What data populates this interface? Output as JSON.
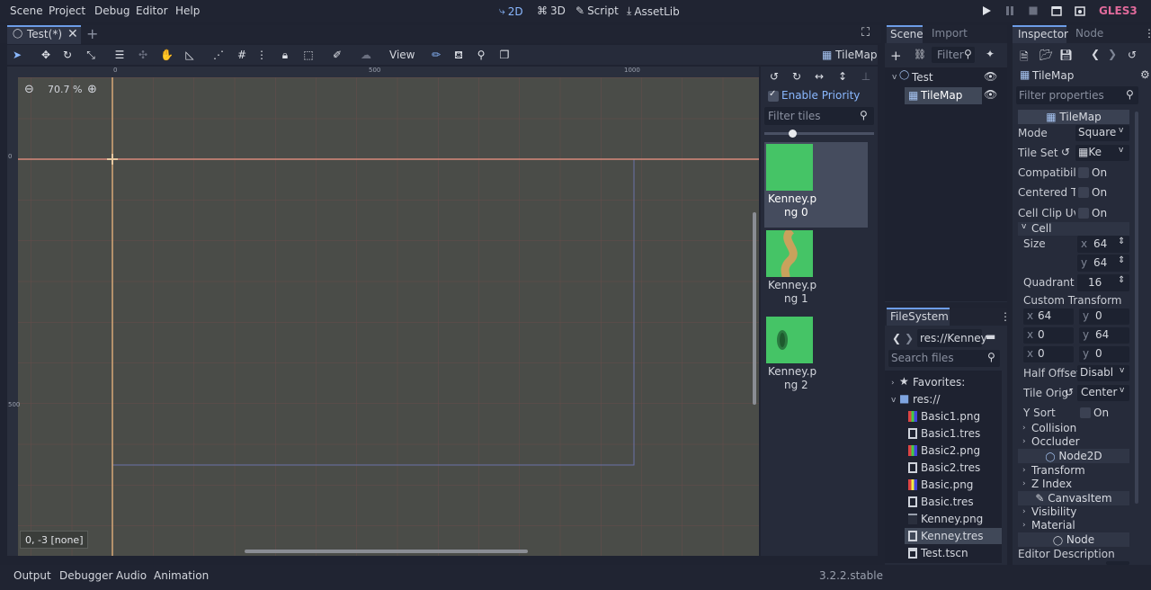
{
  "menu": {
    "items": [
      "Scene",
      "Project",
      "Debug",
      "Editor",
      "Help"
    ]
  },
  "workspaces": {
    "items": [
      "2D",
      "3D",
      "Script",
      "AssetLib"
    ],
    "active": "2D"
  },
  "renderer": {
    "label": "GLES3",
    "color": "#e06a9b"
  },
  "scene_tabs": {
    "tab_label": "Test(*)"
  },
  "toolbar": {
    "view_label": "View",
    "node_label": "TileMap"
  },
  "viewport": {
    "zoom": "70.7 %",
    "status": "0, -3 [none]",
    "ruler_h": [
      "0",
      "500",
      "1000"
    ],
    "ruler_v": [
      "0",
      "500"
    ]
  },
  "tile_palette": {
    "enable_priority": "Enable Priority",
    "filter_placeholder": "Filter tiles",
    "tiles": [
      {
        "label": "Kenney.png 0",
        "line1": "Kenney.p",
        "line2": "ng 0"
      },
      {
        "label": "Kenney.png 1",
        "line1": "Kenney.p",
        "line2": "ng 1"
      },
      {
        "label": "Kenney.png 2",
        "line1": "Kenney.p",
        "line2": "ng 2"
      }
    ]
  },
  "scene_dock": {
    "tabs": [
      "Scene",
      "Import"
    ],
    "filter_placeholder": "Filter",
    "nodes": [
      {
        "name": "Test"
      },
      {
        "name": "TileMap"
      }
    ]
  },
  "filesystem_dock": {
    "title": "FileSystem",
    "path": "res://Kenney",
    "search_placeholder": "Search files",
    "favorites": "Favorites:",
    "root": "res://",
    "files": [
      "Basic1.png",
      "Basic1.tres",
      "Basic2.png",
      "Basic2.tres",
      "Basic.png",
      "Basic.tres",
      "Kenney.png",
      "Kenney.tres",
      "Test.tscn"
    ],
    "selected": "Kenney.tres"
  },
  "inspector": {
    "tabs": [
      "Inspector",
      "Node"
    ],
    "object": "TileMap",
    "filter_placeholder": "Filter properties",
    "section": "TileMap",
    "props": {
      "mode_label": "Mode",
      "mode_value": "Square",
      "tileset_label": "Tile Set",
      "tileset_value": "Ke",
      "compat_label": "Compatibili",
      "compat_value": "On",
      "centered_label": "Centered T",
      "centered_value": "On",
      "clip_label": "Cell Clip Uv",
      "clip_value": "On",
      "cell_group": "Cell",
      "size_label": "Size",
      "size_x": "64",
      "size_y": "64",
      "quadrant_label": "Quadrant S",
      "quadrant_value": "16",
      "custom_transform": "Custom Transform",
      "ct": [
        "64",
        "0",
        "0",
        "64",
        "0",
        "0"
      ],
      "half_offset_label": "Half Offset",
      "half_offset_value": "Disabl",
      "tile_origin_label": "Tile Orig",
      "tile_origin_value": "Center",
      "ysort_label": "Y Sort",
      "ysort_value": "On",
      "collision": "Collision",
      "occluder": "Occluder",
      "node2d": "Node2D",
      "transform": "Transform",
      "zindex": "Z Index",
      "canvasitem": "CanvasItem",
      "visibility": "Visibility",
      "material": "Material",
      "node": "Node",
      "editor_description": "Editor Description"
    }
  },
  "bottom_panel": {
    "tabs": [
      "Output",
      "Debugger",
      "Audio",
      "Animation"
    ],
    "version": "3.2.2.stable"
  },
  "axis_labels": {
    "x": "x",
    "y": "y"
  }
}
